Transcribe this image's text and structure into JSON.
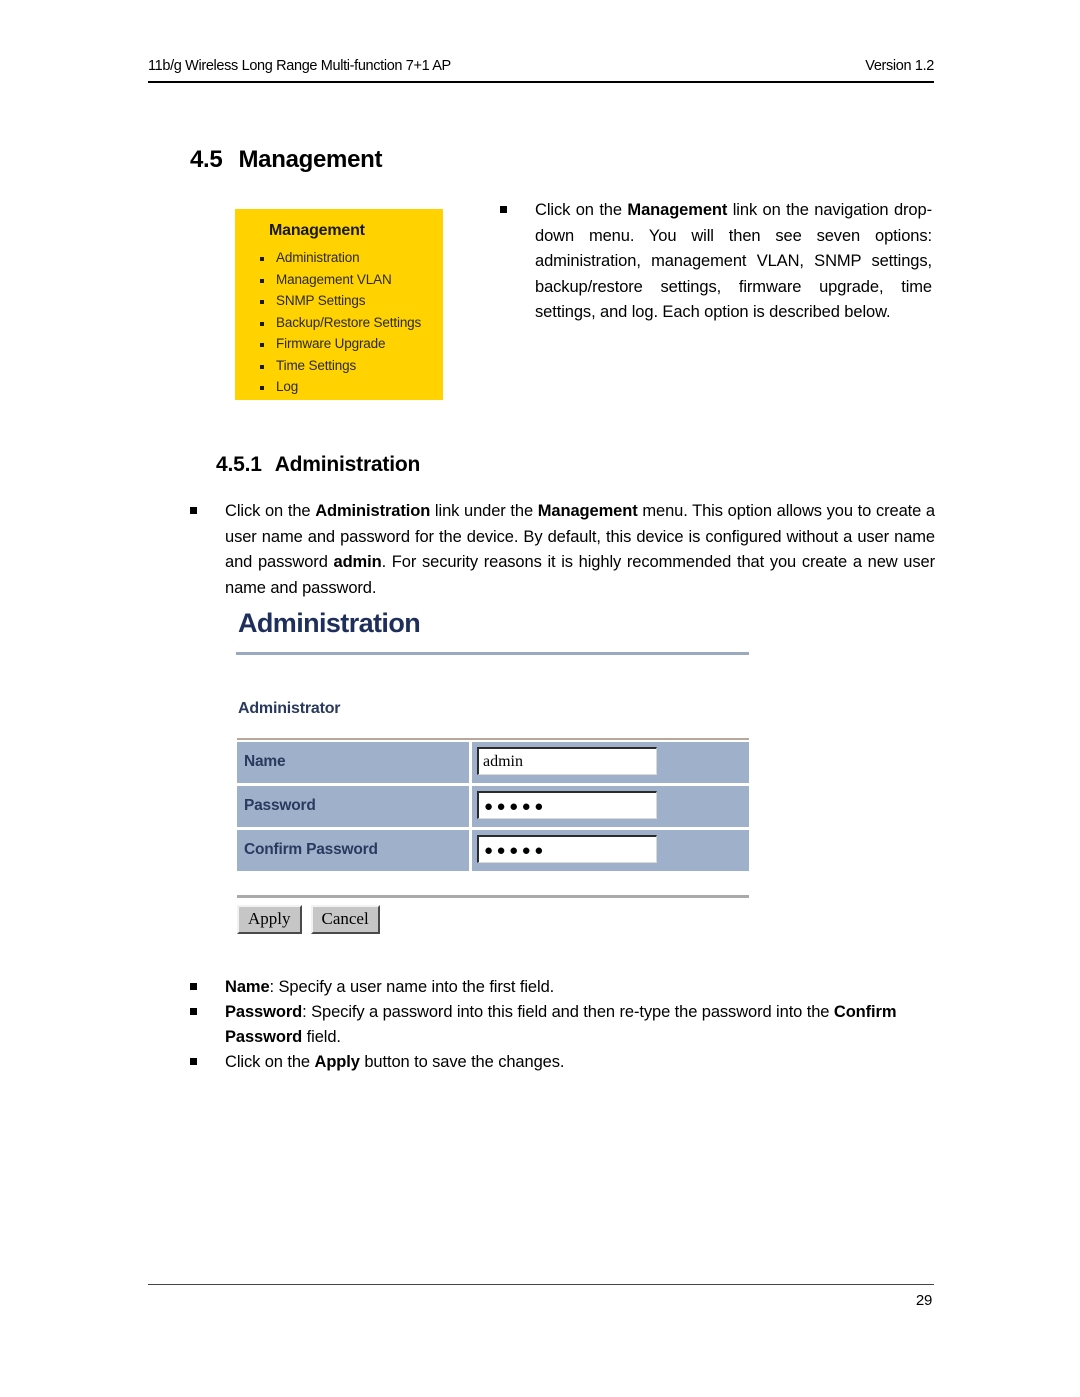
{
  "header": {
    "left_text": "11b/g Wireless Long Range Multi-function 7+1 AP",
    "right_text": "Version 1.2"
  },
  "section_management": {
    "number": "4.5",
    "title": "Management",
    "nav_box": {
      "title": "Management",
      "items": [
        {
          "label": "Administration"
        },
        {
          "label": "Management VLAN"
        },
        {
          "label": "SNMP Settings"
        },
        {
          "label": "Backup/Restore Settings"
        },
        {
          "label": "Firmware Upgrade"
        },
        {
          "label": "Time Settings"
        },
        {
          "label": "Log"
        }
      ],
      "background_color": "#FFD200"
    },
    "intro_paragraph": {
      "part1": "Click on the ",
      "bold1": "Management",
      "part2": " link on the navigation drop-down menu. You will then see seven options: administration, management VLAN, SNMP settings, backup/restore settings, firmware upgrade, time settings, and log. Each option is described below."
    }
  },
  "section_administration": {
    "number": "4.5.1",
    "title": "Administration",
    "intro_paragraph": {
      "part1": "Click on the ",
      "bold1": "Administration",
      "part2": " link under the ",
      "bold2": "Management",
      "part3": " menu. This option allows you to create a user name and password for the device. By default, this device is configured without a user name and password ",
      "bold3": "admin",
      "part4": ". For security reasons it is highly recommended that you create a new user name and password."
    },
    "screenshot": {
      "title": "Administration",
      "title_color": "#1F2F5B",
      "section_label": "Administrator",
      "row_background_color": "#9FB0CB",
      "rows": [
        {
          "label": "Name",
          "value": "admin",
          "masked": false
        },
        {
          "label": "Password",
          "value": "●●●●●",
          "masked": true
        },
        {
          "label": "Confirm Password",
          "value": "●●●●●",
          "masked": true
        }
      ],
      "buttons": [
        {
          "label": "Apply"
        },
        {
          "label": "Cancel"
        }
      ]
    },
    "bullets": [
      {
        "bold1": "Name",
        "text1": ": Specify a user name into the first field."
      },
      {
        "bold1": "Password",
        "text1": ": Specify a password into this field and then re-type the password into the ",
        "bold2": "Confirm Password",
        "text2": " field."
      },
      {
        "text0": "Click on the ",
        "bold1": "Apply",
        "text1": " button to save the changes."
      }
    ]
  },
  "footer": {
    "page_number": "29"
  }
}
